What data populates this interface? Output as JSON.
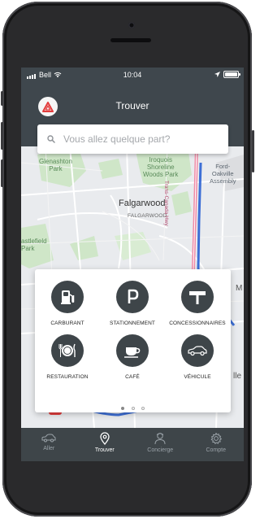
{
  "status_bar": {
    "carrier": "Bell",
    "time": "10:04"
  },
  "header": {
    "title": "Trouver"
  },
  "search": {
    "placeholder": "Vous allez quelque part?"
  },
  "map": {
    "labels": [
      {
        "key": "glanashton",
        "text": "Glenashton\nPark"
      },
      {
        "key": "iroquois",
        "text": "Iroquois\nShoreline\nWoods Park"
      },
      {
        "key": "fordoakville",
        "text": "Ford-\nOakville\nAssembly"
      },
      {
        "key": "falgarwood",
        "text": "Falgarwood"
      },
      {
        "key": "falgarwood_small",
        "text": "FALGARWOOD"
      },
      {
        "key": "castlefield",
        "text": "astlefield\nPark"
      },
      {
        "key": "highway",
        "text": "Trans-Canada Hwy"
      },
      {
        "key": "edge_m",
        "text": "M"
      },
      {
        "key": "edge_lle",
        "text": "lle"
      }
    ]
  },
  "categories": [
    {
      "key": "carburant",
      "label": "CARBURANT",
      "icon": "fuel-pump-icon"
    },
    {
      "key": "stationnement",
      "label": "STATIONNEMENT",
      "icon": "parking-icon"
    },
    {
      "key": "concessionnaires",
      "label": "CONCESSIONNAIRES",
      "icon": "dealership-sign-icon"
    },
    {
      "key": "restauration",
      "label": "RESTAURATION",
      "icon": "plate-cutlery-icon"
    },
    {
      "key": "cafe",
      "label": "CAFÉ",
      "icon": "coffee-cup-icon"
    },
    {
      "key": "vehicule",
      "label": "VÉHICULE",
      "icon": "car-icon"
    }
  ],
  "pagination": {
    "pages": 3,
    "active": 1
  },
  "tabs": [
    {
      "key": "aller",
      "label": "Aller",
      "icon": "car-icon",
      "active": false
    },
    {
      "key": "trouver",
      "label": "Trouver",
      "icon": "location-pin-icon",
      "active": true
    },
    {
      "key": "concierge",
      "label": "Concierge",
      "icon": "concierge-person-icon",
      "active": false
    },
    {
      "key": "compte",
      "label": "Compte",
      "icon": "gear-icon",
      "active": false
    }
  ],
  "colors": {
    "header_bg": "#3f474d",
    "tabbar_bg": "#3e4549",
    "icon_circle": "#3e4549",
    "brand_red": "#e23d3d",
    "route_blue": "#3d6fd6",
    "highway_pink": "#f08aa6"
  }
}
